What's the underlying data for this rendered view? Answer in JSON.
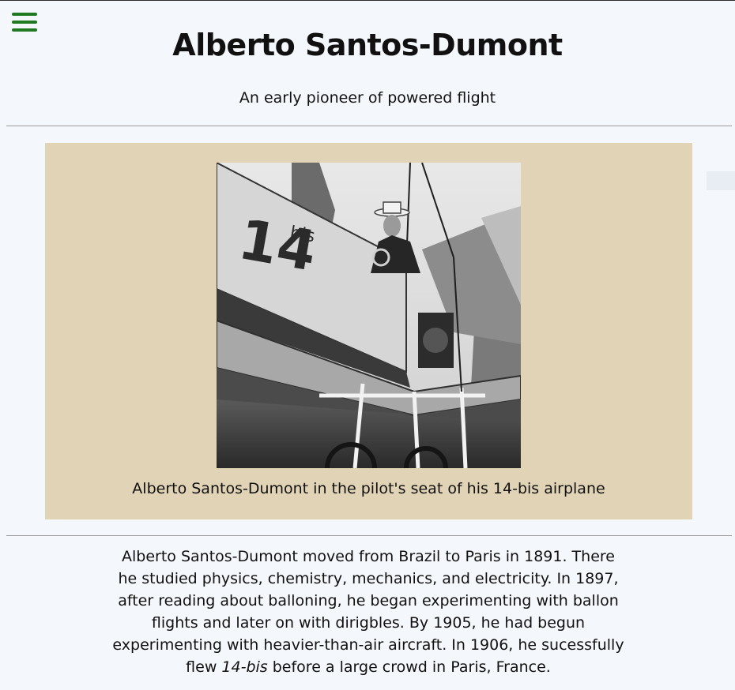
{
  "header": {
    "title": "Alberto Santos-Dumont",
    "subtitle": "An early pioneer of powered flight",
    "menu_icon": "hamburger-menu-icon",
    "menu_color": "#1f7a1f"
  },
  "figure": {
    "image_label_number": "14",
    "image_label_suffix": "bis",
    "caption": "Alberto Santos-Dumont in the pilot's seat of his 14-bis airplane",
    "background": "#e1d3b5"
  },
  "bio": {
    "text_before": "Alberto Santos-Dumont moved from Brazil to Paris in 1891. There he studied physics, chemistry, mechanics, and electricity. In 1897, after reading about balloning, he began experimenting with ballon flights and later on with dirigbles. By 1905, he had begun experimenting with heavier-than-air aircraft. In 1906, he sucessfully flew ",
    "aircraft_name": "14-bis",
    "text_after": " before a large crowd in Paris, France."
  }
}
